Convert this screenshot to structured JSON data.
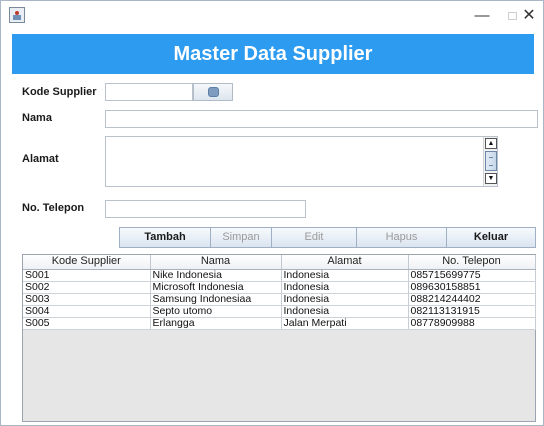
{
  "window": {
    "app_icon": "java-app-icon",
    "minimize_glyph": "—",
    "close_glyph": "✕"
  },
  "header": {
    "title": "Master Data Supplier",
    "background": "#2d9bf0"
  },
  "form": {
    "kode_label": "Kode Supplier",
    "nama_label": "Nama",
    "alamat_label": "Alamat",
    "telepon_label": "No. Telepon",
    "kode_value": "",
    "nama_value": "",
    "alamat_value": "",
    "telepon_value": "",
    "search_icon": "search-icon"
  },
  "buttons": {
    "tambah": "Tambah",
    "simpan": "Simpan",
    "edit": "Edit",
    "hapus": "Hapus",
    "keluar": "Keluar"
  },
  "table": {
    "columns": [
      "Kode Supplier",
      "Nama",
      "Alamat",
      "No. Telepon"
    ],
    "rows": [
      [
        "S001",
        "Nike Indonesia",
        "Indonesia",
        "085715699775"
      ],
      [
        "S002",
        "Microsoft Indonesia",
        "Indonesia",
        "089630158851"
      ],
      [
        "S003",
        "Samsung Indonesiaa",
        "Indonesia",
        "088214244402"
      ],
      [
        "S004",
        "Septo utomo",
        "Indonesia",
        "082113131915"
      ],
      [
        "S005",
        "Erlangga",
        "Jalan Merpati",
        "08778909988"
      ]
    ]
  }
}
